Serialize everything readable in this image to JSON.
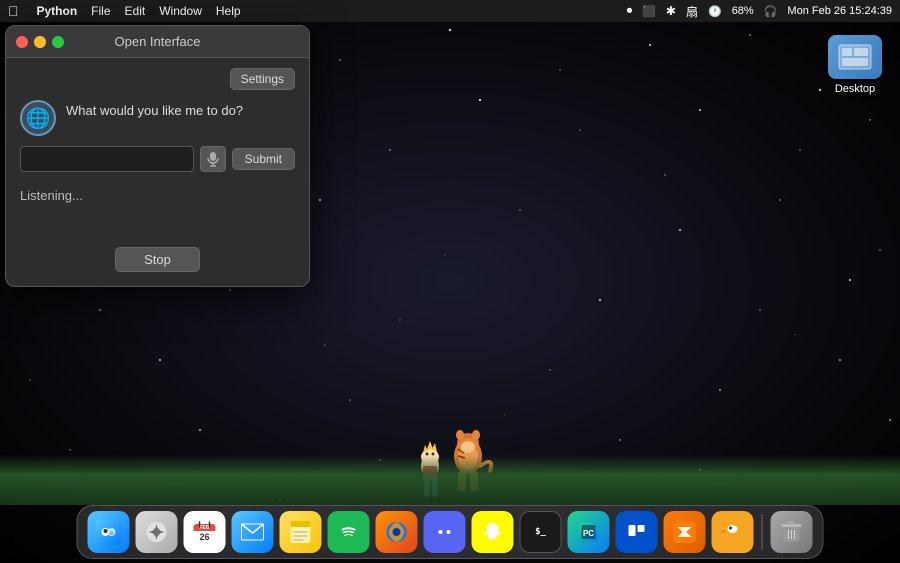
{
  "menubar": {
    "apple": "⌘",
    "app": "Python",
    "menus": [
      "File",
      "Edit",
      "Window",
      "Help"
    ],
    "right": {
      "record": "⏺",
      "display": "▭",
      "bluetooth": "⌘",
      "wifi": "WiFi",
      "battery": "68%",
      "datetime": "Mon Feb 26  15:24:39"
    }
  },
  "dialog": {
    "title": "Open Interface",
    "settings_label": "Settings",
    "globe_icon": "🌐",
    "question": "What would you like me to do?",
    "input_placeholder": "",
    "mic_icon": "🎙",
    "submit_label": "Submit",
    "listening_text": "Listening...",
    "stop_label": "Stop"
  },
  "desktop_icon": {
    "label": "Desktop",
    "icon_text": "≡≡\n≡≡"
  },
  "dock": {
    "items": [
      {
        "name": "finder",
        "icon": "🔍",
        "label": "Finder"
      },
      {
        "name": "launchpad",
        "icon": "⬛",
        "label": "Launchpad"
      },
      {
        "name": "calendar",
        "icon": "📅",
        "label": "Calendar"
      },
      {
        "name": "mail",
        "icon": "✉️",
        "label": "Mail"
      },
      {
        "name": "notes",
        "icon": "📝",
        "label": "Notes"
      },
      {
        "name": "spotify",
        "icon": "♪",
        "label": "Spotify"
      },
      {
        "name": "firefox",
        "icon": "🦊",
        "label": "Firefox"
      },
      {
        "name": "discord",
        "icon": "💬",
        "label": "Discord"
      },
      {
        "name": "snapchat",
        "icon": "👻",
        "label": "Snapchat"
      },
      {
        "name": "terminal",
        "icon": "$_",
        "label": "Terminal"
      },
      {
        "name": "pycharm",
        "icon": "PC",
        "label": "PyCharm"
      },
      {
        "name": "trello",
        "icon": "▦",
        "label": "Trello"
      },
      {
        "name": "sublime",
        "icon": "ST",
        "label": "Sublime"
      },
      {
        "name": "duck",
        "icon": "🦆",
        "label": "CyberDuck"
      },
      {
        "name": "trash",
        "icon": "🗑",
        "label": "Trash"
      }
    ]
  }
}
